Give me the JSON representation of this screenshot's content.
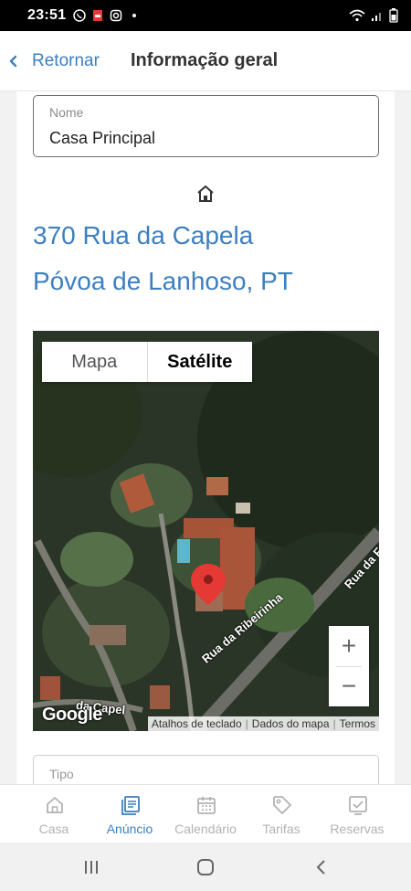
{
  "status_bar": {
    "time": "23:51"
  },
  "header": {
    "back_label": "Retornar",
    "title": "Informação geral"
  },
  "name_field": {
    "label": "Nome",
    "value": "Casa Principal"
  },
  "address": {
    "line1": "370 Rua da Capela",
    "line2": "Póvoa de Lanhoso, PT"
  },
  "map": {
    "tabs": [
      "Mapa",
      "Satélite"
    ],
    "active_tab": "Satélite",
    "google_logo": "Google",
    "road_labels": [
      "da Capel",
      "Rua da Ribeirinha",
      "Rua da F"
    ],
    "footer": [
      "Atalhos de teclado",
      "Dados do mapa",
      "Termos"
    ],
    "zoom_in": "+",
    "zoom_out": "−",
    "pin_color": "#e53935"
  },
  "tipo_field": {
    "label": "Tipo"
  },
  "bottom_nav": {
    "items": [
      {
        "label": "Casa",
        "icon": "house-icon"
      },
      {
        "label": "Anúncio",
        "icon": "listing-icon"
      },
      {
        "label": "Calendário",
        "icon": "calendar-icon"
      },
      {
        "label": "Tarifas",
        "icon": "tag-icon"
      },
      {
        "label": "Reservas",
        "icon": "reservations-icon"
      }
    ],
    "active": "Anúncio"
  },
  "colors": {
    "accent": "#3d7fc1",
    "inactive": "#b2b2b2"
  }
}
